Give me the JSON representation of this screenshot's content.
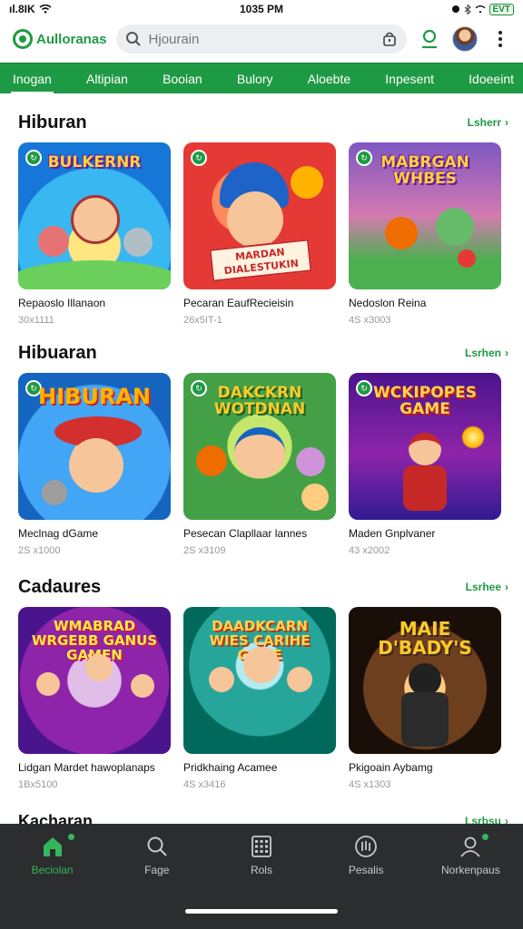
{
  "status": {
    "carrier": "ıl.8IK",
    "time": "1035 PM",
    "battery": "EVT"
  },
  "header": {
    "logo_text": "Aulloranas",
    "search_placeholder": "Hjourain"
  },
  "tabs": [
    "Inogan",
    "Altipian",
    "Booian",
    "Bulory",
    "Aloebte",
    "Inpesent",
    "Idoeeint"
  ],
  "see_more": "Lsherr",
  "sections": [
    {
      "title": "Hiburan",
      "see_more": "Lsherr",
      "cards": [
        {
          "thumb_title": "BULKERNR",
          "name": "Repaoslo Illanaon",
          "meta": "30x1111"
        },
        {
          "thumb_title": "MARDAN DIALESTUKIN",
          "name": "Pecaran EaufRecieisin",
          "meta": "26x5IT-1"
        },
        {
          "thumb_title": "MABRGAN WHBES",
          "name": "Nedoslon Reina",
          "meta": "4S x3003"
        }
      ]
    },
    {
      "title": "Hibuaran",
      "see_more": "Lsrhen",
      "cards": [
        {
          "thumb_title": "HIBURAN",
          "name": "Meclnag dGame",
          "meta": "2S x1000"
        },
        {
          "thumb_title": "DAKCKRN WOTDNAN",
          "name": "Pesecan Clapllaar lannes",
          "meta": "2S x3109"
        },
        {
          "thumb_title": "WCKIPOPES GAME",
          "name": "Maden Gnplvaner",
          "meta": "43 x2002"
        }
      ]
    },
    {
      "title": "Cadaures",
      "see_more": "Lsrhee",
      "cards": [
        {
          "thumb_title": "WMABRAD WRGEBB GANUS GAMEN",
          "name": "Lidgan Mardet hawoplanaps",
          "meta": "1Bx5100"
        },
        {
          "thumb_title": "DAADKCARN WIES CARIHE GAME",
          "name": "Pridkhaing Acamee",
          "meta": "4S x3416"
        },
        {
          "thumb_title": "MAIE D'BADY'S",
          "name": "Pkigoain Aybamg",
          "meta": "4S x1303"
        }
      ]
    },
    {
      "title": "Kacharan",
      "see_more": "Lsrbsu",
      "cards": []
    }
  ],
  "bottom_nav": [
    {
      "label": "Beciolan",
      "icon": "home-icon",
      "active": true
    },
    {
      "label": "Fage",
      "icon": "search-icon",
      "active": false
    },
    {
      "label": "Rols",
      "icon": "grid-icon",
      "active": false
    },
    {
      "label": "Pesalis",
      "icon": "badge-icon",
      "active": false
    },
    {
      "label": "Norkenpaus",
      "icon": "profile-icon",
      "active": false
    }
  ],
  "colors": {
    "brand": "#1f9a44",
    "nav_bg": "#2b2d2f"
  }
}
